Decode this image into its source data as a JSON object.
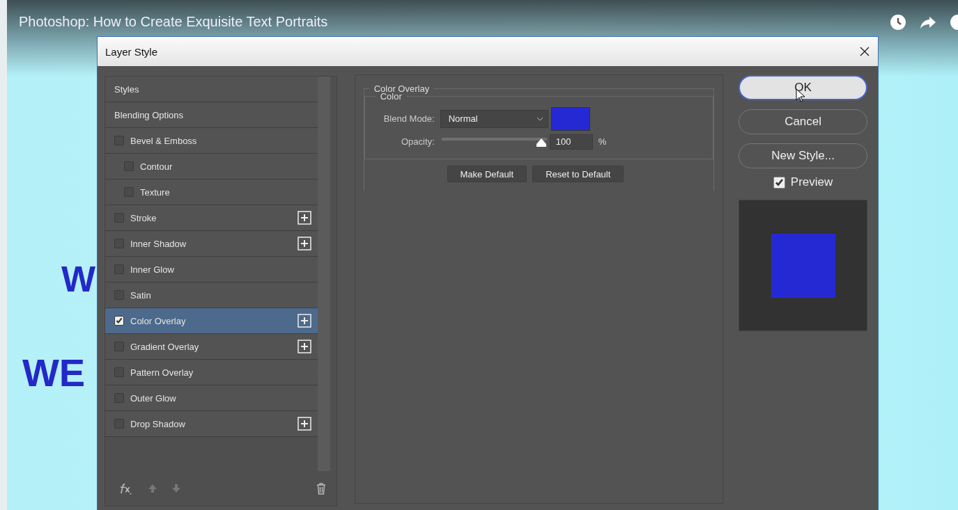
{
  "video": {
    "title": "Photoshop: How to Create Exquisite Text Portraits",
    "canvas_texts": [
      "W",
      "WE"
    ]
  },
  "dialog": {
    "title": "Layer Style",
    "styles": [
      {
        "label": "Styles",
        "kind": "header",
        "selected": false
      },
      {
        "label": "Blending Options",
        "kind": "header",
        "selected": false
      },
      {
        "label": "Bevel & Emboss",
        "kind": "check",
        "checked": false,
        "add": false,
        "selected": false,
        "children": [
          {
            "label": "Contour",
            "kind": "check",
            "checked": false,
            "add": false,
            "selected": false
          },
          {
            "label": "Texture",
            "kind": "check",
            "checked": false,
            "add": false,
            "selected": false
          }
        ]
      },
      {
        "label": "Stroke",
        "kind": "check",
        "checked": false,
        "add": true,
        "selected": false
      },
      {
        "label": "Inner Shadow",
        "kind": "check",
        "checked": false,
        "add": true,
        "selected": false
      },
      {
        "label": "Inner Glow",
        "kind": "check",
        "checked": false,
        "add": false,
        "selected": false
      },
      {
        "label": "Satin",
        "kind": "check",
        "checked": false,
        "add": false,
        "selected": false
      },
      {
        "label": "Color Overlay",
        "kind": "check",
        "checked": true,
        "add": true,
        "selected": true
      },
      {
        "label": "Gradient Overlay",
        "kind": "check",
        "checked": false,
        "add": true,
        "selected": false
      },
      {
        "label": "Pattern Overlay",
        "kind": "check",
        "checked": false,
        "add": false,
        "selected": false
      },
      {
        "label": "Outer Glow",
        "kind": "check",
        "checked": false,
        "add": false,
        "selected": false
      },
      {
        "label": "Drop Shadow",
        "kind": "check",
        "checked": false,
        "add": true,
        "selected": false
      }
    ],
    "panel": {
      "section_title": "Color Overlay",
      "group_title": "Color",
      "blend_mode_label": "Blend Mode:",
      "blend_mode": "Normal",
      "color": "#2529d4",
      "opacity_label": "Opacity:",
      "opacity": {
        "level": 1.0,
        "value": "100",
        "unit": "%"
      },
      "buttons": [
        "Make Default",
        "Reset to Default"
      ]
    },
    "actions": [
      {
        "label": "OK",
        "default": true
      },
      {
        "label": "Cancel",
        "default": false
      },
      {
        "label": "New Style...",
        "default": false
      }
    ],
    "preview": {
      "label": "Preview",
      "checked": true
    }
  }
}
